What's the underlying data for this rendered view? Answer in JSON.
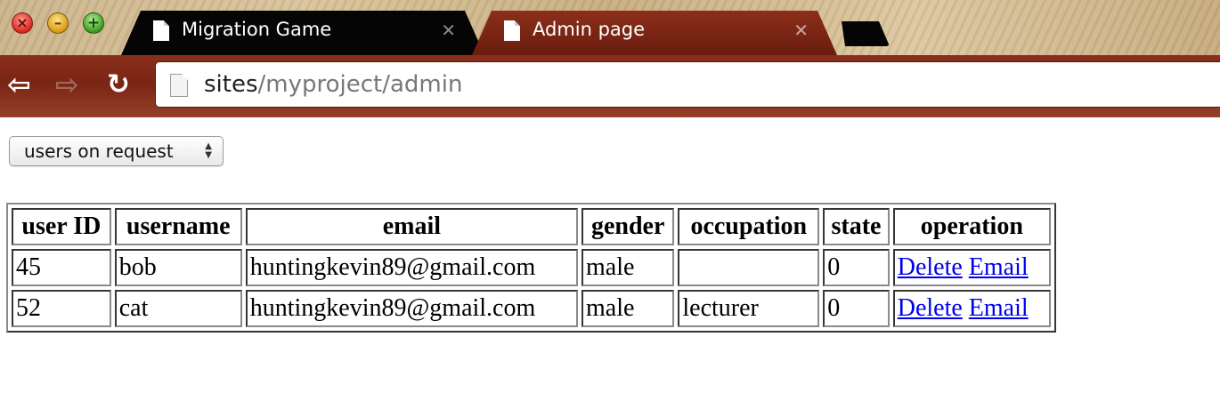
{
  "browser": {
    "window_controls": {
      "close_icon": "close-icon",
      "minimize_icon": "minimize-icon",
      "maximize_icon": "maximize-icon"
    },
    "tabs": [
      {
        "title": "Migration Game",
        "active": false
      },
      {
        "title": "Admin page",
        "active": true
      }
    ],
    "address": {
      "host": "sites",
      "path": "/myproject/admin"
    },
    "colors": {
      "toolbar": "#7a2514",
      "active_tab": "#7d2614",
      "inactive_tab": "#050505"
    }
  },
  "page": {
    "filter_select": {
      "selected": "users on request"
    },
    "table": {
      "headers": [
        "user ID",
        "username",
        "email",
        "gender",
        "occupation",
        "state",
        "operation"
      ],
      "rows": [
        {
          "user_id": "45",
          "username": "bob",
          "email": "huntingkevin89@gmail.com",
          "gender": "male",
          "occupation": "",
          "state": "0",
          "delete_label": "Delete",
          "email_label": "Email"
        },
        {
          "user_id": "52",
          "username": "cat",
          "email": "huntingkevin89@gmail.com",
          "gender": "male",
          "occupation": "lecturer",
          "state": "0",
          "delete_label": "Delete",
          "email_label": "Email"
        }
      ]
    }
  }
}
